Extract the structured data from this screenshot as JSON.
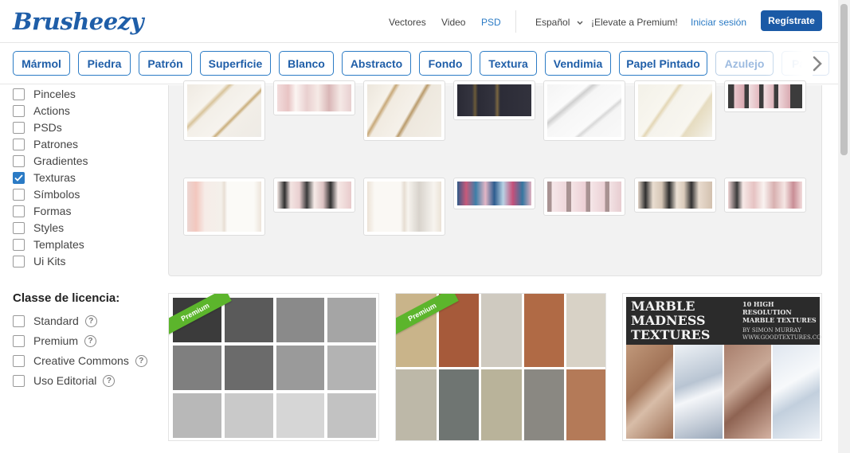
{
  "header": {
    "logo": "Brusheezy",
    "nav": {
      "vectors": "Vectores",
      "video": "Video",
      "psd": "PSD"
    },
    "language": "Español",
    "premium": "¡Elevate a Premium!",
    "login": "Iniciar sesión",
    "register": "Regístrate"
  },
  "tags": [
    "Mármol",
    "Piedra",
    "Patrón",
    "Superficie",
    "Blanco",
    "Abstracto",
    "Fondo",
    "Textura",
    "Vendimia",
    "Papel Pintado",
    "Azulejo",
    "Pa"
  ],
  "filters": {
    "types": [
      {
        "label": "Pinceles",
        "checked": false
      },
      {
        "label": "Actions",
        "checked": false
      },
      {
        "label": "PSDs",
        "checked": false
      },
      {
        "label": "Patrones",
        "checked": false
      },
      {
        "label": "Gradientes",
        "checked": false
      },
      {
        "label": "Texturas",
        "checked": true
      },
      {
        "label": "Símbolos",
        "checked": false
      },
      {
        "label": "Formas",
        "checked": false
      },
      {
        "label": "Styles",
        "checked": false
      },
      {
        "label": "Templates",
        "checked": false
      },
      {
        "label": "Ui Kits",
        "checked": false
      }
    ],
    "license_title": "Classe de licencia:",
    "license": [
      {
        "label": "Standard",
        "help": "?"
      },
      {
        "label": "Premium",
        "help": "?"
      },
      {
        "label": "Creative Commons",
        "help": "?"
      },
      {
        "label": "Uso Editorial",
        "help": "?"
      }
    ]
  },
  "cards": {
    "premium_badge": "Premium",
    "marble_title_1": "MARBLE",
    "marble_title_2": "MADNESS",
    "marble_title_3": "TEXTURES",
    "marble_sub_1": "10 HIGH RESOLUTION",
    "marble_sub_2": "MARBLE TEXTURES",
    "marble_author_1": "BY SIMON MURRAY",
    "marble_author_2": "WWW.GOODTEXTURES.COM"
  },
  "icons": {
    "chevron_right": "chevron-right-icon",
    "chevron_down": "chevron-down-icon",
    "check": "check-icon",
    "help": "help-icon"
  },
  "colors": {
    "brand": "#1f5ea8",
    "accent": "#2b7bc5",
    "premium_green": "#5cb52c",
    "register_bg": "#1b5aa6"
  }
}
